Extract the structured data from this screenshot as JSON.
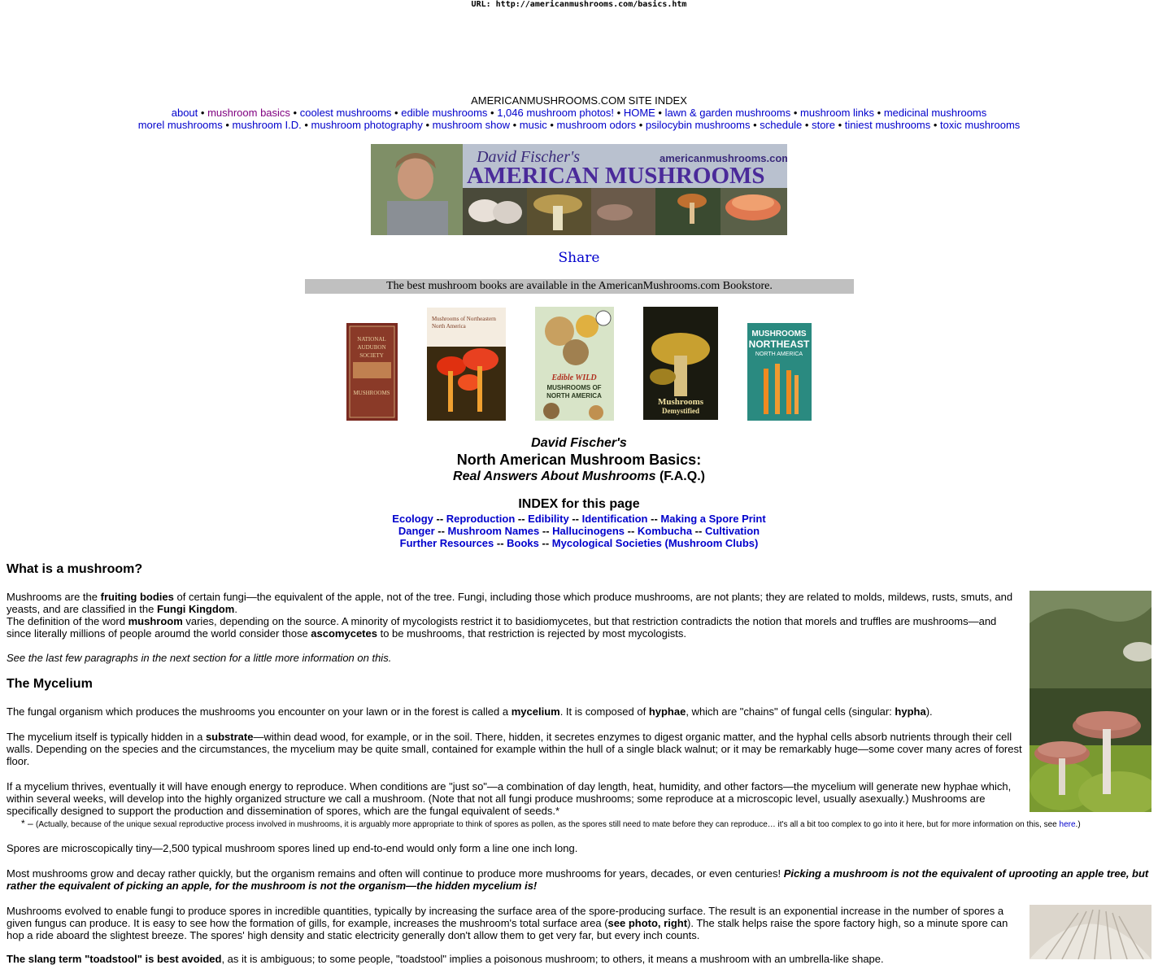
{
  "url_bar": "URL: http://americanmushrooms.com/basics.htm",
  "site_index": {
    "title": "AMERICANMUSHROOMS.COM SITE INDEX",
    "row1": [
      "about",
      "mushroom basics",
      "coolest mushrooms",
      "edible mushrooms",
      "1,046 mushroom photos!",
      "HOME",
      "lawn & garden mushrooms",
      "mushroom links",
      "medicinal mushrooms"
    ],
    "row2": [
      "morel mushrooms",
      "mushroom I.D.",
      "mushroom photography",
      "mushroom show",
      "music",
      "mushroom odors",
      "psilocybin mushrooms",
      "schedule",
      "store",
      "tiniest mushrooms",
      "toxic mushrooms"
    ],
    "separator": "•"
  },
  "banner": {
    "title_small": "David Fischer's",
    "title_big": "AMERICAN MUSHROOMS",
    "site": "americanmushrooms.com"
  },
  "share": "Share",
  "bookstore_bar": "The best mushroom books are available in the AmericanMushrooms.com Bookstore.",
  "books": [
    {
      "label": "NATIONAL AUDUBON SOCIETY",
      "sub": "MUSHROOMS"
    },
    {
      "label": "Mushrooms of Northeastern North America",
      "sub": ""
    },
    {
      "label": "Edible WILD MUSHROOMS OF NORTH AMERICA",
      "sub": ""
    },
    {
      "label": "Mushrooms Demystified",
      "sub": "by David Arora"
    },
    {
      "label": "MUSHROOMS NORTHEAST",
      "sub": "NORTH AMERICA"
    }
  ],
  "header": {
    "author": "David Fischer's",
    "title": "North American Mushroom Basics:",
    "subtitle_em": "Real Answers About Mushrooms",
    "subtitle_rest": " (F.A.Q.)"
  },
  "page_index": {
    "title": "INDEX for this page",
    "line1": [
      "Ecology",
      "Reproduction",
      "Edibility",
      "Identification",
      "Making a Spore Print"
    ],
    "line2": [
      "Danger",
      "Mushroom Names",
      "Hallucinogens",
      "Kombucha",
      "Cultivation"
    ],
    "line3": [
      "Further Resources",
      "Books",
      "Mycological Societies (Mushroom Clubs)"
    ],
    "sep": "--"
  },
  "sections": {
    "what_is": "What is a mushroom?",
    "mycelium": "The Mycelium"
  },
  "paragraphs": {
    "p1_a": "Mushrooms are the ",
    "p1_b": "fruiting bodies",
    "p1_c": " of certain fungi—the equivalent of the apple, not of the tree. Fungi, including those which produce mushrooms, are not plants; they are related to molds, mildews, rusts, smuts, and yeasts, and are classified in the ",
    "p1_d": "Fungi Kingdom",
    "p1_e": ".",
    "p2_a": "The definition of the word ",
    "p2_b": "mushroom",
    "p2_c": " varies, depending on the source. A minority of mycologists restrict it to basidiomycetes, but that restriction contradicts the notion that morels and truffles are mushrooms—and since literally millions of people aroumd the world consider those ",
    "p2_d": "ascomycetes",
    "p2_e": " to be mushrooms, that restriction is rejected by most mycologists.",
    "p3": "See the last few paragraphs in the next section for a little more information on this.",
    "p4_a": "The fungal organism which produces the mushrooms you encounter on your lawn or in the forest is called a ",
    "p4_b": "mycelium",
    "p4_c": ". It is composed of ",
    "p4_d": "hyphae",
    "p4_e": ", which are \"chains\" of fungal cells (singular: ",
    "p4_f": "hypha",
    "p4_g": ").",
    "p5_a": "The mycelium itself is typically hidden in a ",
    "p5_b": "substrate",
    "p5_c": "—within dead wood, for example, or in the soil. There, hidden, it secretes enzymes to digest organic matter, and the hyphal cells absorb nutrients through their cell walls. Depending on the species and the circumstances, the mycelium may be quite small, contained for example within the hull of a single black walnut; or it may be remarkably huge—some cover many acres of forest floor.",
    "p6": "If a mycelium thrives, eventually it will have enough energy to reproduce. When conditions are \"just so\"—a combination of day length, heat, humidity, and other factors—the mycelium will generate new hyphae which, within several weeks, will develop into the highly organized structure we call a mushroom. (Note that not all fungi produce mushrooms; some reproduce at a microscopic level, usually asexually.) Mushrooms are specifically designed to support the production and dissemination of spores, which are the fungal equivalent of seeds.*",
    "note_a": "* – ",
    "note_b": "(Actually, because of the unique sexual reproductive process involved in mushrooms, it is arguably more appropriate to think of spores as pollen, as the spores still need to mate before they can reproduce… it's all a bit too complex to go into it here, but for more information on this, see ",
    "note_link": "here",
    "note_c": ".)",
    "p7": "Spores are microscopically tiny—2,500 typical mushroom spores lined up end-to-end would only form a line one inch long.",
    "p8_a": "Most mushrooms grow and decay rather quickly, but the organism remains and often will continue to produce more mushrooms for years, decades, or even centuries! ",
    "p8_b": "Picking a mushroom is not the equivalent of uprooting an apple tree, but rather the equivalent of picking an apple, for the mushroom is not the organism—the hidden mycelium is!",
    "p9_a": "Mushrooms evolved to enable fungi to produce spores in incredible quantities, typically by increasing the surface area of the spore-producing surface. The result is an exponential increase in the number of spores a given fungus can produce. It is easy to see how the formation of gills, for example, increases the mushroom's total surface area (",
    "p9_b": "see photo, right",
    "p9_c": "). The stalk helps raise the spore factory high, so a minute spore can hop a ride aboard the slightest breeze. The spores' high density and static electricity generally don't allow them to get very far, but every inch counts.",
    "p10_a": "The slang term \"toadstool\" is best avoided",
    "p10_b": ", as it is ambiguous; to some people, \"toadstool\" implies a poisonous mushroom; to others, it means a mushroom with an umbrella-like shape."
  },
  "colors": {
    "link": "#0000cc",
    "visited": "#800080",
    "bookbar": "#c0c0c0"
  }
}
